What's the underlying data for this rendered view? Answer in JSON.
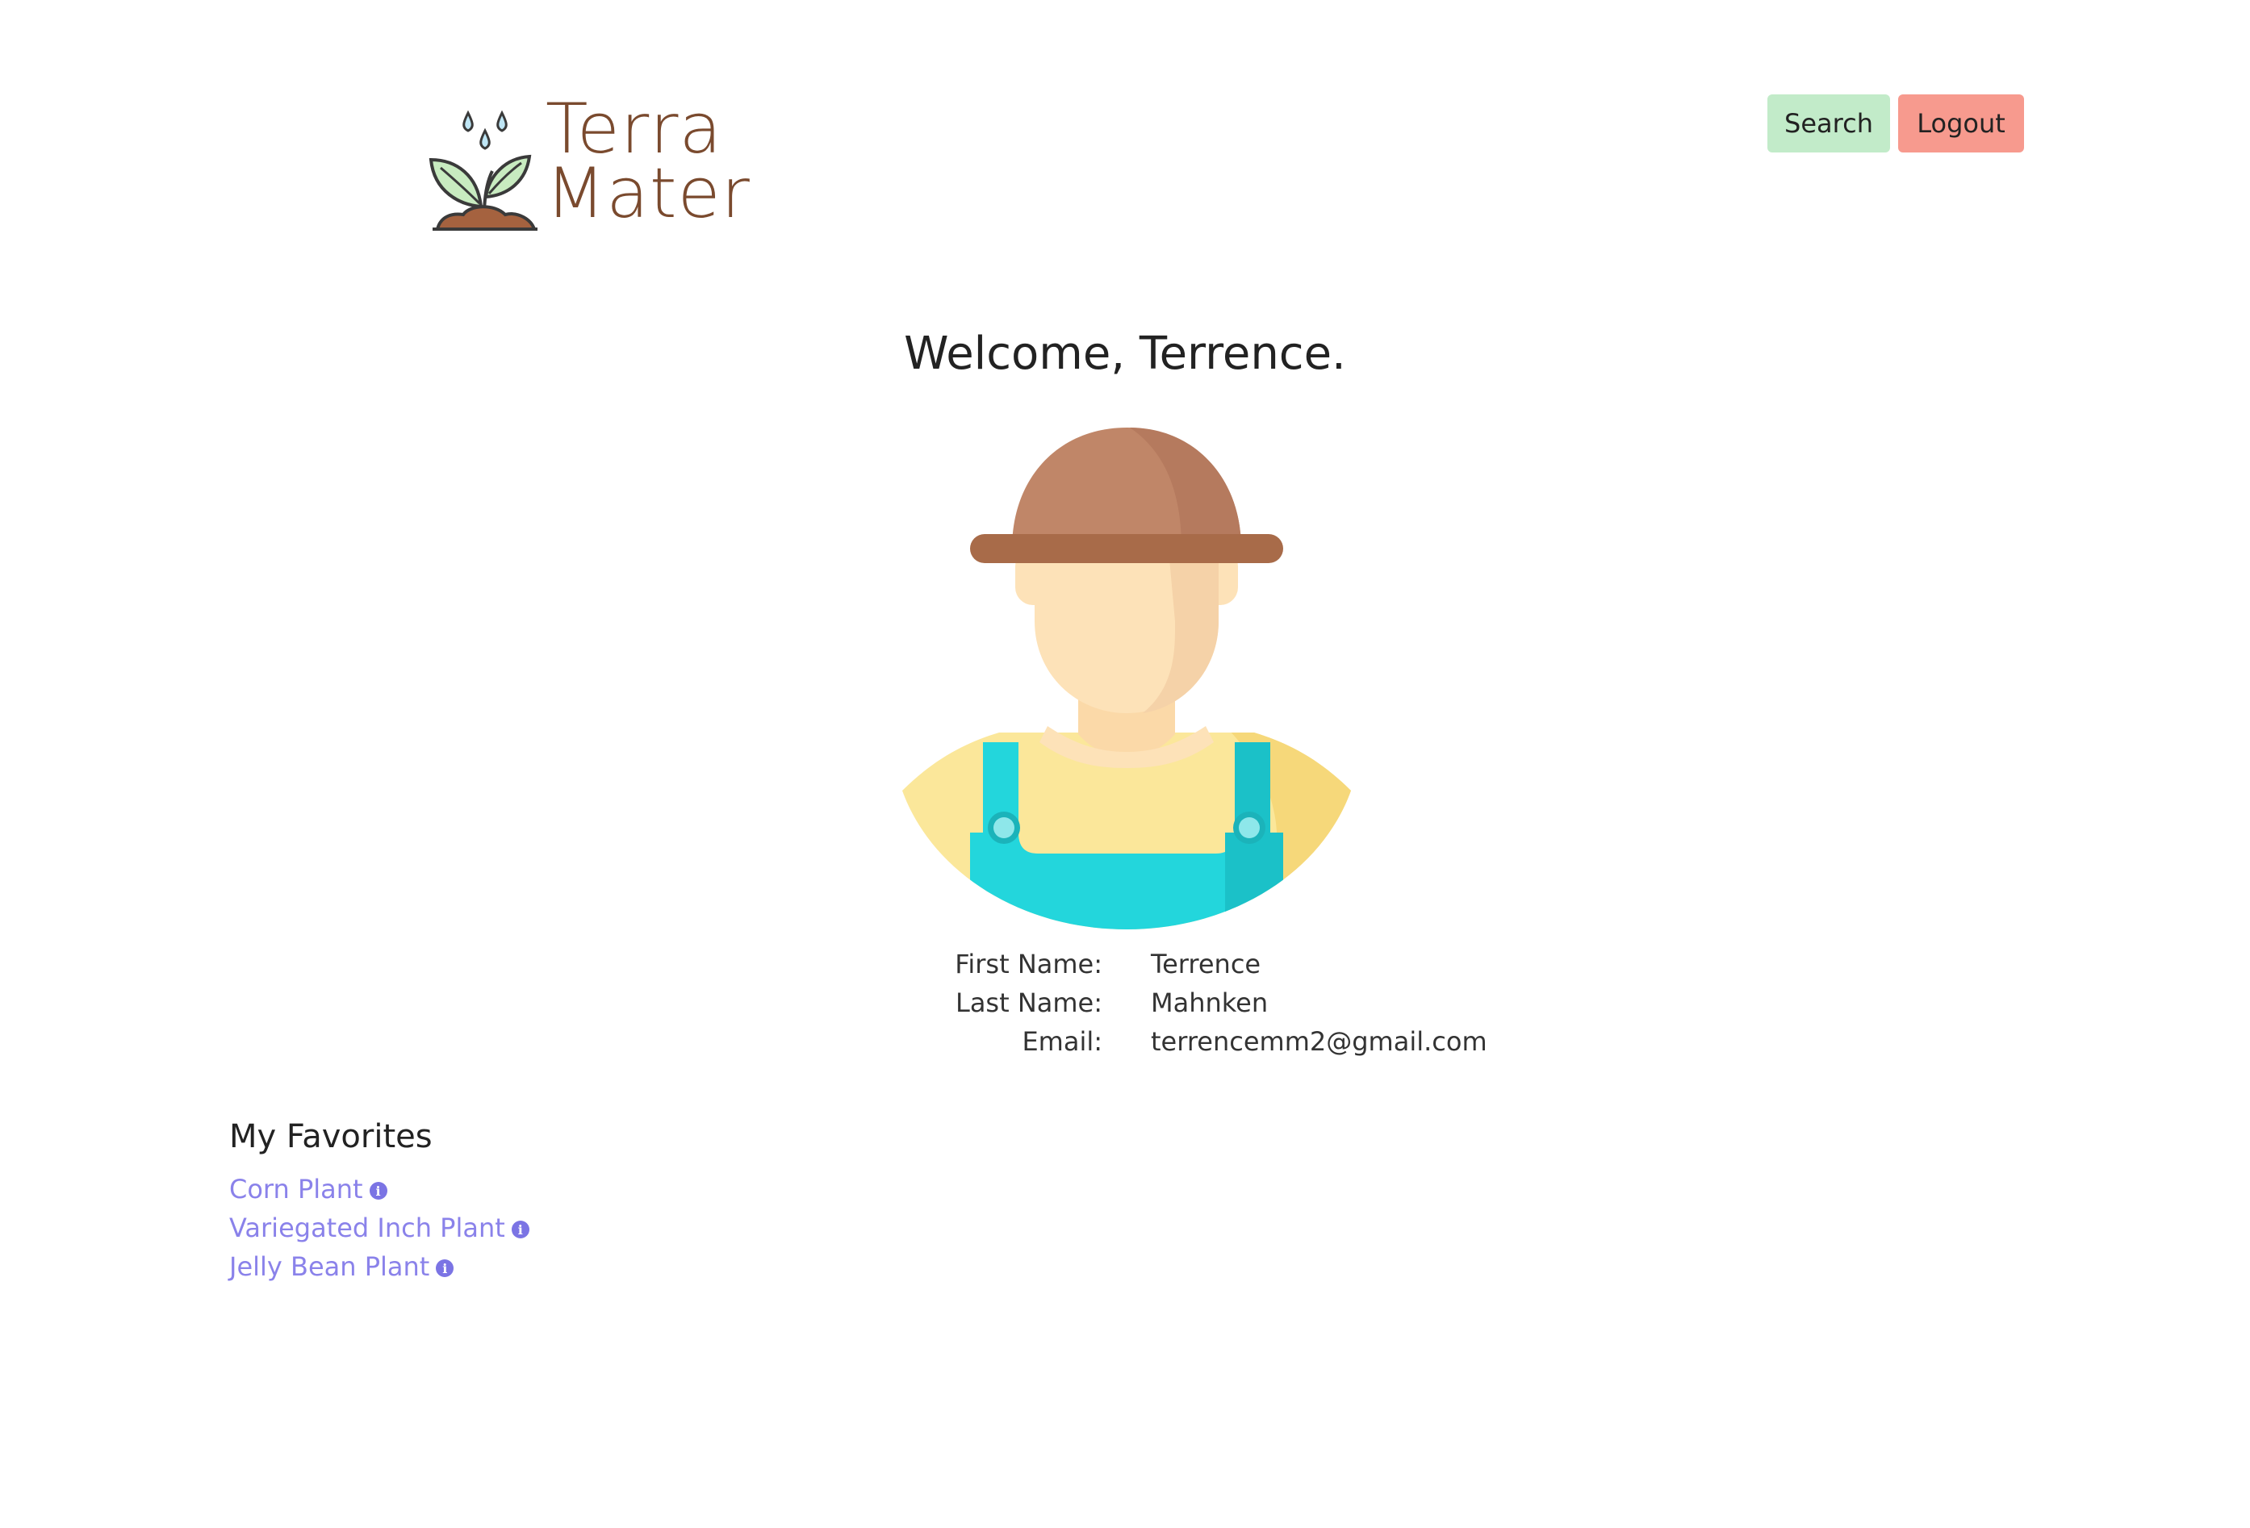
{
  "header": {
    "logo": {
      "line1": "Terra",
      "line2": "Mater"
    },
    "nav": {
      "search_label": "Search",
      "logout_label": "Logout"
    }
  },
  "main": {
    "welcome": "Welcome, Terrence.",
    "avatar_icon": "farmer-avatar-icon",
    "profile": [
      {
        "label": "First Name:",
        "value": "Terrence"
      },
      {
        "label": "Last Name:",
        "value": "Mahnken"
      },
      {
        "label": "Email:",
        "value": "terrencemm2@gmail.com"
      }
    ],
    "favorites": {
      "title": "My Favorites",
      "items": [
        {
          "label": "Corn Plant",
          "icon": "info-icon"
        },
        {
          "label": "Variegated Inch Plant",
          "icon": "info-icon"
        },
        {
          "label": "Jelly Bean Plant",
          "icon": "info-icon"
        }
      ]
    }
  },
  "colors": {
    "search_button": "#c2ebc9",
    "logout_button": "#f79a8e",
    "link": "#8a82ea",
    "logo_text": "#7a4a2e"
  }
}
